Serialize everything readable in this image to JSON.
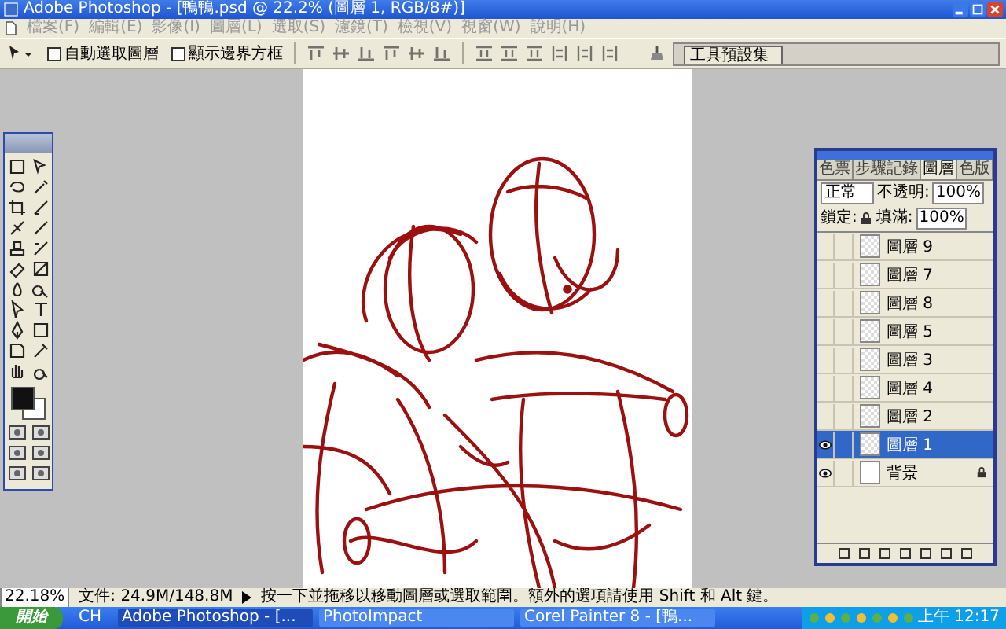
{
  "window": {
    "title": "Adobe Photoshop - [鴨鴨.psd @ 22.2% (圖層 1, RGB/8#)]"
  },
  "menu": [
    "檔案(F)",
    "編輯(E)",
    "影像(I)",
    "圖層(L)",
    "選取(S)",
    "濾鏡(T)",
    "檢視(V)",
    "視窗(W)",
    "說明(H)"
  ],
  "options": {
    "checkboxes": [
      {
        "label": "自動選取圖層",
        "checked": false
      },
      {
        "label": "顯示邊界方框",
        "checked": false
      }
    ],
    "presets_tab": "工具預設集"
  },
  "layers_panel": {
    "tabs": [
      {
        "label": "色票",
        "selected": false
      },
      {
        "label": "步驟記錄",
        "selected": false
      },
      {
        "label": "圖層",
        "selected": true
      },
      {
        "label": "色版",
        "selected": false
      }
    ],
    "blend_mode": "正常",
    "opacity_label": "不透明:",
    "opacity": "100%",
    "lock_label": "鎖定:",
    "fill_label": "填滿:",
    "fill": "100%",
    "layers": [
      {
        "name": "圖層 9",
        "visible": false,
        "selected": false,
        "locked": false
      },
      {
        "name": "圖層 7",
        "visible": false,
        "selected": false,
        "locked": false
      },
      {
        "name": "圖層 8",
        "visible": false,
        "selected": false,
        "locked": false
      },
      {
        "name": "圖層 5",
        "visible": false,
        "selected": false,
        "locked": false
      },
      {
        "name": "圖層 3",
        "visible": false,
        "selected": false,
        "locked": false
      },
      {
        "name": "圖層 4",
        "visible": false,
        "selected": false,
        "locked": false
      },
      {
        "name": "圖層 2",
        "visible": false,
        "selected": false,
        "locked": false
      },
      {
        "name": "圖層 1",
        "visible": true,
        "selected": true,
        "locked": false
      },
      {
        "name": "背景",
        "visible": true,
        "selected": false,
        "locked": true
      }
    ]
  },
  "status_bar": {
    "zoom": "22.18%",
    "doc_size": "文件: 24.9M/148.8M",
    "hint": "按一下並拖移以移動圖層或選取範圍。額外的選項請使用 Shift 和 Alt 鍵。"
  },
  "taskbar": {
    "start": "開始",
    "language": "CH",
    "tasks": [
      {
        "label": "Adobe Photoshop - [...",
        "active": true
      },
      {
        "label": "PhotoImpact",
        "active": false
      },
      {
        "label": "Corel Painter 8 - [鴨...",
        "active": false
      }
    ],
    "clock": "上午 12:17"
  }
}
